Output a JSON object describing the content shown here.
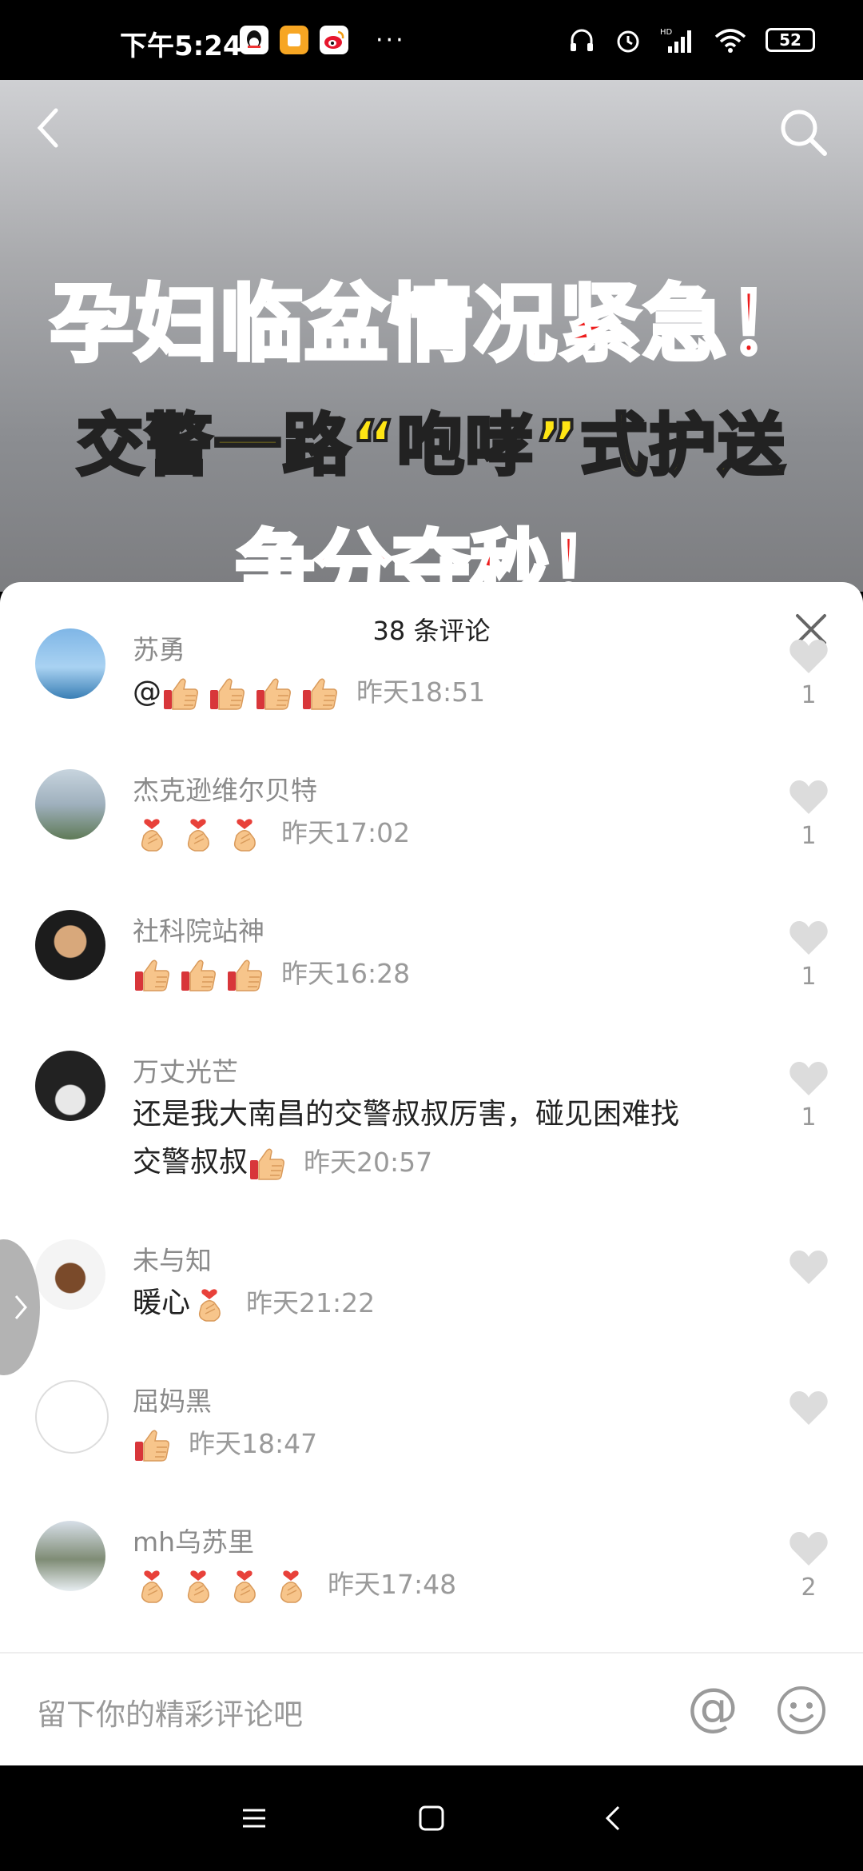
{
  "status_bar": {
    "time": "下午5:24",
    "battery": "52",
    "more": "···"
  },
  "video": {
    "headline_1": "孕妇临盆情况紧急！",
    "headline_2": "交警一路“咆哮”式护送",
    "headline_3": "争分夺秒！"
  },
  "sheet": {
    "title": "38 条评论",
    "input_placeholder": "留下你的精彩评论吧",
    "at_symbol": "@"
  },
  "comments": [
    {
      "name": "苏勇",
      "text": "@",
      "emojis": [
        "thumbs-up",
        "thumbs-up",
        "thumbs-up",
        "thumbs-up"
      ],
      "time": "昨天18:51",
      "likes": "1"
    },
    {
      "name": "杰克逊维尔贝特",
      "text": "",
      "emojis": [
        "finger-heart",
        "finger-heart",
        "finger-heart"
      ],
      "time": "昨天17:02",
      "likes": "1"
    },
    {
      "name": "社科院站神",
      "text": "",
      "emojis": [
        "thumbs-up",
        "thumbs-up",
        "thumbs-up"
      ],
      "time": "昨天16:28",
      "likes": "1"
    },
    {
      "name": "万丈光芒",
      "text_line1": "还是我大南昌的交警叔叔厉害，碰见困难找",
      "text": "交警叔叔",
      "emojis": [
        "thumbs-up"
      ],
      "time": "昨天20:57",
      "likes": "1"
    },
    {
      "name": "未与知",
      "text": "暖心",
      "emojis": [
        "finger-heart"
      ],
      "time": "昨天21:22",
      "likes": ""
    },
    {
      "name": "屈妈黑",
      "text": "",
      "emojis": [
        "thumbs-up"
      ],
      "time": "昨天18:47",
      "likes": ""
    },
    {
      "name": "mh乌苏里",
      "text": "",
      "emojis": [
        "finger-heart",
        "finger-heart",
        "finger-heart",
        "finger-heart"
      ],
      "time": "昨天17:48",
      "likes": "2"
    }
  ],
  "colors": {
    "headline_red": "#ee1c1c",
    "headline_yellow": "#ffe514",
    "muted_text": "#8a8a8a"
  }
}
